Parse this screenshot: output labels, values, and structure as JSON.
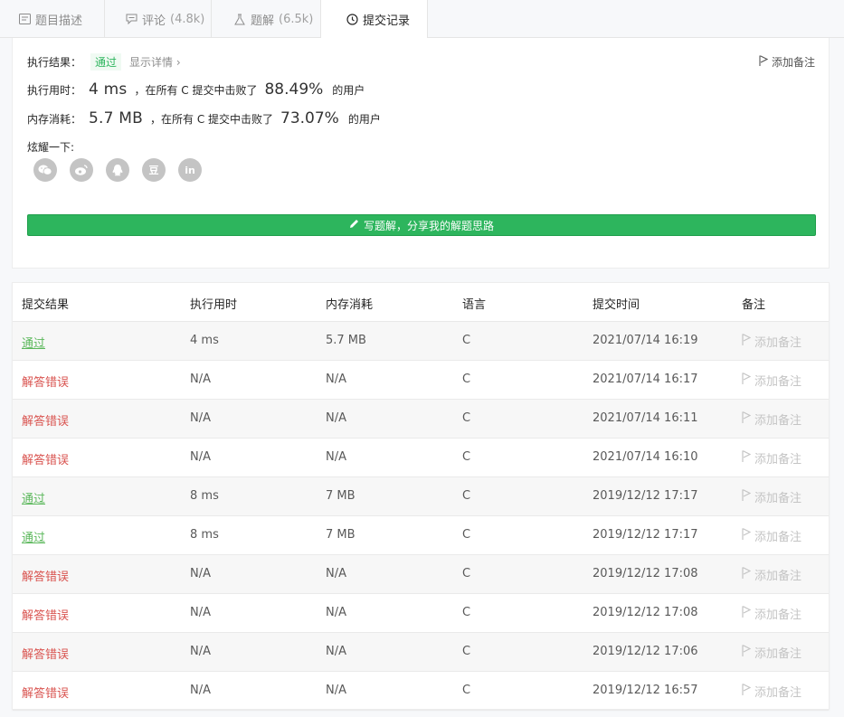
{
  "tabs": [
    {
      "label": "题目描述",
      "count": "",
      "icon": "document-icon"
    },
    {
      "label": "评论",
      "count": "(4.8k)",
      "icon": "comment-icon"
    },
    {
      "label": "题解",
      "count": "(6.5k)",
      "icon": "flask-icon"
    },
    {
      "label": "提交记录",
      "count": "",
      "icon": "clock-icon",
      "active": true
    }
  ],
  "result": {
    "result_label": "执行结果：",
    "result_value": "通过",
    "detail_link": "显示详情 ›",
    "add_note": "添加备注",
    "time_label": "执行用时：",
    "time_value": "4 ms",
    "time_mid": "，在所有 C 提交中击败了",
    "time_pct": "88.49%",
    "time_suffix": "的用户",
    "mem_label": "内存消耗：",
    "mem_value": "5.7 MB",
    "mem_mid": "，在所有 C 提交中击败了",
    "mem_pct": "73.07%",
    "mem_suffix": "的用户",
    "share_label": "炫耀一下:",
    "socials": [
      "wechat-icon",
      "weibo-icon",
      "qq-icon",
      "douban-icon",
      "linkedin-icon"
    ],
    "douban_text": "豆",
    "linkedin_text": "in",
    "write_button": "写题解，分享我的解题思路"
  },
  "colors": {
    "accent": "#2db55d",
    "pass": "#5cb85c",
    "fail": "#d9534f"
  },
  "table": {
    "headers": [
      "提交结果",
      "执行用时",
      "内存消耗",
      "语言",
      "提交时间",
      "备注"
    ],
    "rows": [
      {
        "status": "通过",
        "pass": true,
        "time": "4 ms",
        "mem": "5.7 MB",
        "lang": "C",
        "submitted": "2021/07/14 16:19",
        "note": "添加备注"
      },
      {
        "status": "解答错误",
        "pass": false,
        "time": "N/A",
        "mem": "N/A",
        "lang": "C",
        "submitted": "2021/07/14 16:17",
        "note": "添加备注"
      },
      {
        "status": "解答错误",
        "pass": false,
        "time": "N/A",
        "mem": "N/A",
        "lang": "C",
        "submitted": "2021/07/14 16:11",
        "note": "添加备注"
      },
      {
        "status": "解答错误",
        "pass": false,
        "time": "N/A",
        "mem": "N/A",
        "lang": "C",
        "submitted": "2021/07/14 16:10",
        "note": "添加备注"
      },
      {
        "status": "通过",
        "pass": true,
        "time": "8 ms",
        "mem": "7 MB",
        "lang": "C",
        "submitted": "2019/12/12 17:17",
        "note": "添加备注"
      },
      {
        "status": "通过",
        "pass": true,
        "time": "8 ms",
        "mem": "7 MB",
        "lang": "C",
        "submitted": "2019/12/12 17:17",
        "note": "添加备注"
      },
      {
        "status": "解答错误",
        "pass": false,
        "time": "N/A",
        "mem": "N/A",
        "lang": "C",
        "submitted": "2019/12/12 17:08",
        "note": "添加备注"
      },
      {
        "status": "解答错误",
        "pass": false,
        "time": "N/A",
        "mem": "N/A",
        "lang": "C",
        "submitted": "2019/12/12 17:08",
        "note": "添加备注"
      },
      {
        "status": "解答错误",
        "pass": false,
        "time": "N/A",
        "mem": "N/A",
        "lang": "C",
        "submitted": "2019/12/12 17:06",
        "note": "添加备注"
      },
      {
        "status": "解答错误",
        "pass": false,
        "time": "N/A",
        "mem": "N/A",
        "lang": "C",
        "submitted": "2019/12/12 16:57",
        "note": "添加备注"
      }
    ]
  }
}
